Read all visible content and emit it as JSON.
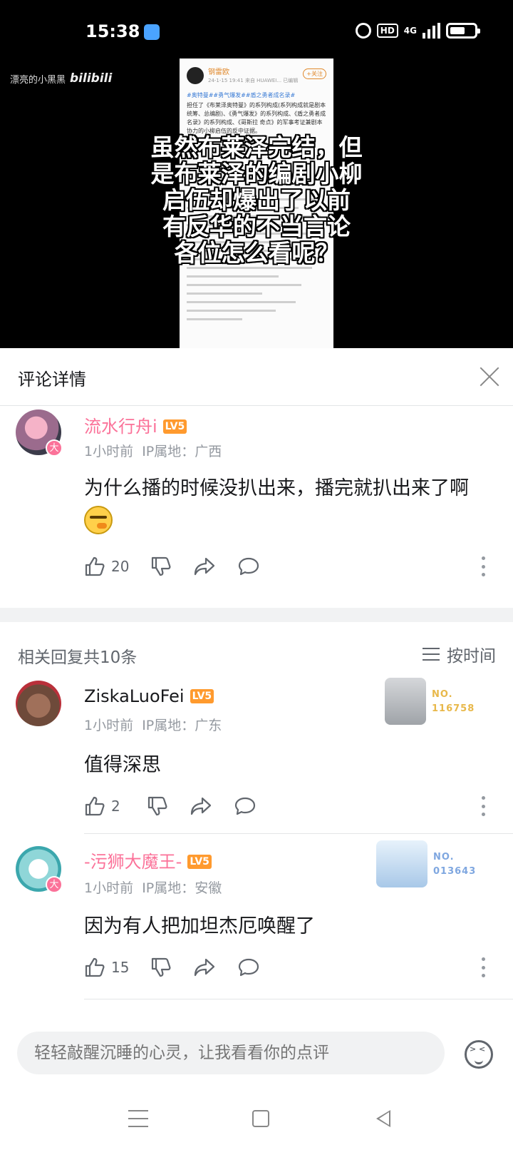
{
  "status_bar": {
    "time": "15:38",
    "hd": "HD",
    "network": "4G"
  },
  "video": {
    "watermark_user": "漂亮的小黑黑",
    "watermark_brand": "bilibili",
    "subtitle_lines": [
      "虽然布莱泽完结，但",
      "是布莱泽的编剧小柳",
      "启伍却爆出了以前",
      "有反华的不当言论",
      "各位怎么看呢？"
    ],
    "embedded_post": {
      "name": "钢雷欧",
      "meta": "24-1-15 19:41 来自 HUAWEI... 已编辑",
      "location": "发布于 北京",
      "follow": "+关注",
      "tags": "#奥特曼##勇气爆发##盾之勇者成名录#",
      "body": "担任了《布莱泽奥特曼》的系列构成(系列构成就是剧本统筹、总编剧)、《勇气爆发》的系列构成、《盾之勇者成名录》的系列构成、《哥斯拉 奇点》的军事考证兼剧本协力的小柳启伍的反中证据。"
    }
  },
  "panel": {
    "title": "评论详情"
  },
  "main_comment": {
    "username": "流水行舟i",
    "level": "LV5",
    "vip_badge": "大",
    "time": "1小时前",
    "ip": "IP属地：广西",
    "text": "为什么播的时候没扒出来，播完就扒出来了啊",
    "likes": "20"
  },
  "replies_header": {
    "count_label": "相关回复共10条",
    "sort_label": "按时间"
  },
  "replies": [
    {
      "username": "ZiskaLuoFei",
      "level": "LV5",
      "time": "1小时前",
      "ip": "IP属地：广东",
      "text": "值得深思",
      "likes": "2",
      "fan_no": "NO.\n116758",
      "fan_color": "#e8b84a"
    },
    {
      "username": "-污狮大魔王-",
      "level": "LV5",
      "vip_badge": "大",
      "time": "1小时前",
      "ip": "IP属地：安徽",
      "text": "因为有人把加坦杰厄唤醒了",
      "likes": "15",
      "fan_no": "NO.\n013643",
      "fan_color": "#7fa7e0"
    }
  ],
  "input": {
    "placeholder": "轻轻敲醒沉睡的心灵，让我看看你的点评"
  },
  "icons": [
    "like-icon",
    "dislike-icon",
    "share-icon",
    "reply-icon",
    "more-icon",
    "close-icon",
    "sort-icon",
    "emoji-icon"
  ],
  "colors": {
    "pink": "#fb7299",
    "level": "#ff9a2e",
    "meta": "#9499a0"
  }
}
